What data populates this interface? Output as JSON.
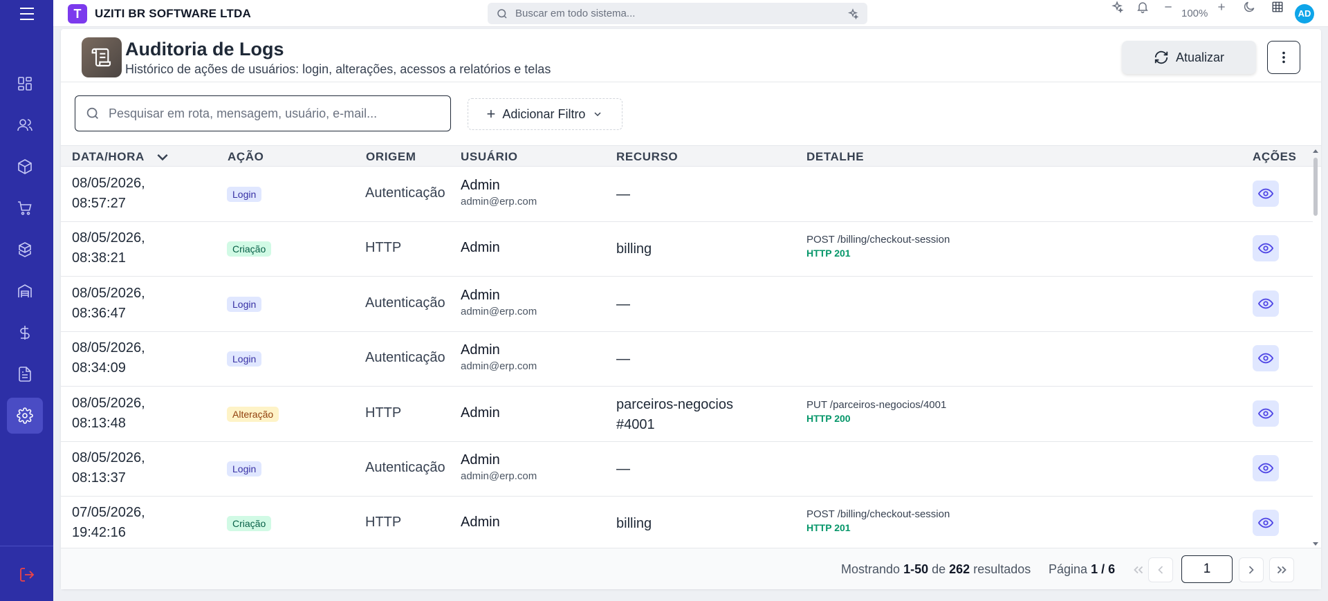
{
  "app": {
    "company": "UZITI BR SOFTWARE LTDA",
    "logo_letter": "T",
    "search_placeholder": "Buscar em todo sistema...",
    "zoom": "100%",
    "avatar_initials": "AD"
  },
  "page": {
    "title": "Auditoria de Logs",
    "subtitle": "Histórico de ações de usuários: login, alterações, acessos a relatórios e telas",
    "refresh_label": "Atualizar",
    "search_placeholder": "Pesquisar em rota, mensagem, usuário, e-mail...",
    "filter_label": "Adicionar Filtro"
  },
  "table": {
    "columns": [
      "DATA/HORA",
      "AÇÃO",
      "ORIGEM",
      "USUÁRIO",
      "RECURSO",
      "DETALHE",
      "AÇÕES"
    ],
    "rows": [
      {
        "date": "08/05/2026,",
        "time": "08:57:27",
        "action": "Login",
        "action_type": "login",
        "origem": "Autenticação",
        "user": "Admin",
        "email": "admin@erp.com",
        "recurso": "—",
        "recurso2": "",
        "detail": "",
        "status": ""
      },
      {
        "date": "08/05/2026,",
        "time": "08:38:21",
        "action": "Criação",
        "action_type": "criacao",
        "origem": "HTTP",
        "user": "Admin",
        "email": "",
        "recurso": "billing",
        "recurso2": "",
        "detail": "POST /billing/checkout-session",
        "status": "HTTP 201"
      },
      {
        "date": "08/05/2026,",
        "time": "08:36:47",
        "action": "Login",
        "action_type": "login",
        "origem": "Autenticação",
        "user": "Admin",
        "email": "admin@erp.com",
        "recurso": "—",
        "recurso2": "",
        "detail": "",
        "status": ""
      },
      {
        "date": "08/05/2026,",
        "time": "08:34:09",
        "action": "Login",
        "action_type": "login",
        "origem": "Autenticação",
        "user": "Admin",
        "email": "admin@erp.com",
        "recurso": "—",
        "recurso2": "",
        "detail": "",
        "status": ""
      },
      {
        "date": "08/05/2026,",
        "time": "08:13:48",
        "action": "Alteração",
        "action_type": "alteracao",
        "origem": "HTTP",
        "user": "Admin",
        "email": "",
        "recurso": "parceiros-negocios",
        "recurso2": "#4001",
        "detail": "PUT /parceiros-negocios/4001",
        "status": "HTTP 200"
      },
      {
        "date": "08/05/2026,",
        "time": "08:13:37",
        "action": "Login",
        "action_type": "login",
        "origem": "Autenticação",
        "user": "Admin",
        "email": "admin@erp.com",
        "recurso": "—",
        "recurso2": "",
        "detail": "",
        "status": ""
      },
      {
        "date": "07/05/2026,",
        "time": "19:42:16",
        "action": "Criação",
        "action_type": "criacao",
        "origem": "HTTP",
        "user": "Admin",
        "email": "",
        "recurso": "billing",
        "recurso2": "",
        "detail": "POST /billing/checkout-session",
        "status": "HTTP 201"
      }
    ]
  },
  "footer": {
    "showing_prefix": "Mostrando",
    "range": "1-50",
    "of": "de",
    "total": "262",
    "results": "resultados",
    "page_prefix": "Página",
    "page_of": "1 / 6",
    "page_input": "1"
  },
  "colors": {
    "sidebar": "#2d2fa6",
    "accent": "#7c3aed",
    "success": "#059669"
  }
}
